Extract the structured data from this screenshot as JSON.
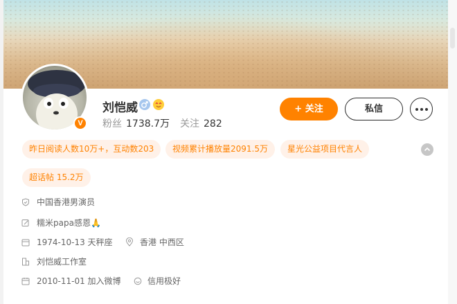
{
  "profile": {
    "name": "刘恺威",
    "avatar_badge": "V",
    "fans_label": "粉丝",
    "fans_value": "1738.7万",
    "follow_label": "关注",
    "follow_value": "282"
  },
  "actions": {
    "follow": "+ 关注",
    "message": "私信"
  },
  "tags": [
    "昨日阅读人数10万+，互动数203",
    "视频累计播放量2091.5万",
    "星光公益项目代言人",
    "超话帖 15.2万"
  ],
  "info": {
    "identity": "中国香港男演员",
    "bio": "糯米papa感恩🙏",
    "birthday": "1974-10-13 天秤座",
    "location": "香港 中西区",
    "company": "刘恺威工作室",
    "joined": "2010-11-01 加入微博",
    "credit": "信用极好"
  },
  "icons": {
    "gender": "male-icon",
    "vip": "vip-emoji-icon",
    "collapse": "chevron-up-icon"
  },
  "colors": {
    "accent": "#ff8200",
    "tag_bg": "#fff1e8"
  }
}
